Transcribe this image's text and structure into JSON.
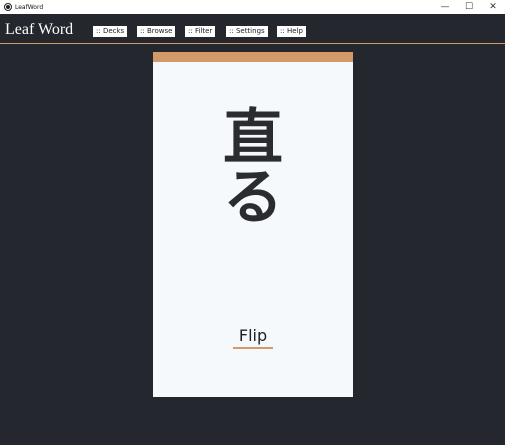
{
  "window": {
    "title": "LeafWord",
    "minimize": "—",
    "maximize": "☐",
    "close": "✕"
  },
  "toolbar": {
    "logo": "Leaf Word",
    "nav": [
      {
        "label": ":: Decks"
      },
      {
        "label": ":: Browse"
      },
      {
        "label": ":: Filter"
      },
      {
        "label": ":: Settings"
      },
      {
        "label": ":: Help"
      }
    ]
  },
  "card": {
    "word_lines": [
      "直",
      "る"
    ],
    "flip_label": "Flip"
  },
  "colors": {
    "accent": "#d29a68",
    "background": "#24272e",
    "card": "#f5f9fb"
  }
}
